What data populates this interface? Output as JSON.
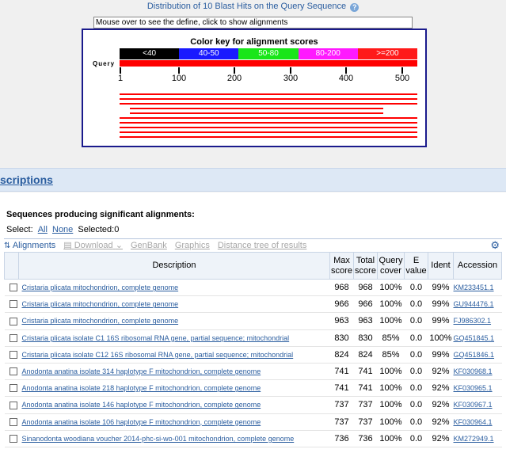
{
  "graphic": {
    "title": "Distribution of 10 Blast Hits on the Query Sequence",
    "mouseover_text": "Mouse over to see the define, click to show alignments",
    "color_key_title": "Color key for alignment scores",
    "color_key": [
      {
        "label": "<40",
        "color": "#000000"
      },
      {
        "label": "40-50",
        "color": "#1a1aff"
      },
      {
        "label": "50-80",
        "color": "#19e619"
      },
      {
        "label": "80-200",
        "color": "#ff19ff"
      },
      {
        "label": ">=200",
        "color": "#ff1a1a"
      }
    ],
    "query_label": "Query",
    "ruler_ticks": [
      "1",
      "100",
      "200",
      "300",
      "400",
      "500"
    ]
  },
  "descriptions_header": "scriptions",
  "seq_title": "Sequences producing significant alignments:",
  "select": {
    "label": "Select:",
    "all": "All",
    "none": "None",
    "selected": "Selected:0"
  },
  "toolbar": {
    "alignments": "Alignments",
    "download": "Download",
    "genbank": "GenBank",
    "graphics": "Graphics",
    "distance_tree": "Distance tree of results"
  },
  "table": {
    "headers": {
      "description": "Description",
      "max_score": "Max score",
      "total_score": "Total score",
      "query_cover": "Query cover",
      "e_value": "E value",
      "ident": "Ident",
      "accession": "Accession"
    },
    "rows": [
      {
        "description": "Cristaria plicata mitochondrion, complete genome",
        "max_score": "968",
        "total_score": "968",
        "query_cover": "100%",
        "e_value": "0.0",
        "ident": "99%",
        "accession": "KM233451.1"
      },
      {
        "description": "Cristaria plicata mitochondrion, complete genome",
        "max_score": "966",
        "total_score": "966",
        "query_cover": "100%",
        "e_value": "0.0",
        "ident": "99%",
        "accession": "GU944476.1"
      },
      {
        "description": "Cristaria plicata mitochondrion, complete genome",
        "max_score": "963",
        "total_score": "963",
        "query_cover": "100%",
        "e_value": "0.0",
        "ident": "99%",
        "accession": "FJ986302.1"
      },
      {
        "description": "Cristaria plicata isolate C1 16S ribosomal RNA gene, partial sequence; mitochondrial",
        "max_score": "830",
        "total_score": "830",
        "query_cover": "85%",
        "e_value": "0.0",
        "ident": "100%",
        "accession": "GQ451845.1"
      },
      {
        "description": "Cristaria plicata isolate C12 16S ribosomal RNA gene, partial sequence; mitochondrial",
        "max_score": "824",
        "total_score": "824",
        "query_cover": "85%",
        "e_value": "0.0",
        "ident": "99%",
        "accession": "GQ451846.1"
      },
      {
        "description": "Anodonta anatina isolate 314 haplotype F mitochondrion, complete genome",
        "max_score": "741",
        "total_score": "741",
        "query_cover": "100%",
        "e_value": "0.0",
        "ident": "92%",
        "accession": "KF030968.1"
      },
      {
        "description": "Anodonta anatina isolate 218 haplotype F mitochondrion, complete genome",
        "max_score": "741",
        "total_score": "741",
        "query_cover": "100%",
        "e_value": "0.0",
        "ident": "92%",
        "accession": "KF030965.1"
      },
      {
        "description": "Anodonta anatina isolate 146 haplotype F mitochondrion, complete genome",
        "max_score": "737",
        "total_score": "737",
        "query_cover": "100%",
        "e_value": "0.0",
        "ident": "92%",
        "accession": "KF030967.1"
      },
      {
        "description": "Anodonta anatina isolate 106 haplotype F mitochondrion, complete genome",
        "max_score": "737",
        "total_score": "737",
        "query_cover": "100%",
        "e_value": "0.0",
        "ident": "92%",
        "accession": "KF030964.1"
      },
      {
        "description": "Sinanodonta woodiana voucher 2014-phc-si-wo-001 mitochondrion, complete genome",
        "max_score": "736",
        "total_score": "736",
        "query_cover": "100%",
        "e_value": "0.0",
        "ident": "92%",
        "accession": "KM272949.1"
      }
    ]
  }
}
